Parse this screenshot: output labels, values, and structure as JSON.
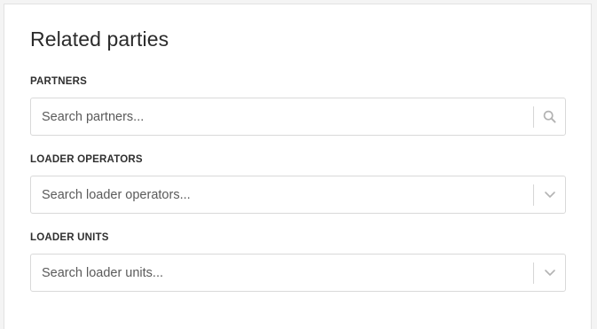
{
  "section": {
    "title": "Related parties"
  },
  "fields": {
    "partners": {
      "label": "PARTNERS",
      "placeholder": "Search partners...",
      "icon": "search-icon"
    },
    "loader_operators": {
      "label": "LOADER OPERATORS",
      "placeholder": "Search loader operators...",
      "icon": "chevron-down-icon"
    },
    "loader_units": {
      "label": "LOADER UNITS",
      "placeholder": "Search loader units...",
      "icon": "chevron-down-icon"
    }
  },
  "colors": {
    "icon": "#b3b3b3",
    "border": "#d9d9d9"
  }
}
